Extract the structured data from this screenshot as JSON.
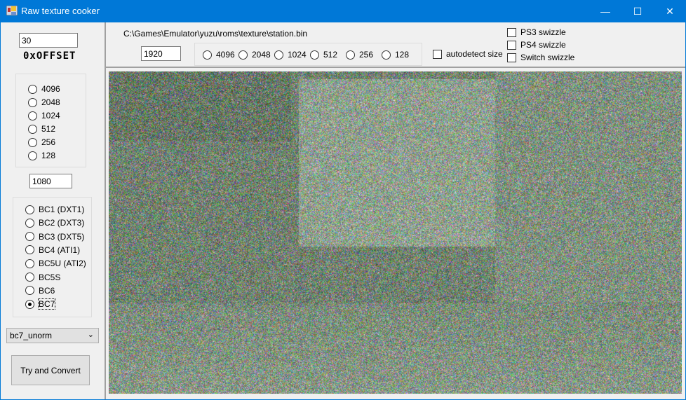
{
  "window": {
    "title": "Raw texture cooker",
    "icon": "app-icon",
    "controls": [
      "minimize-icon",
      "maximize-icon",
      "close-icon"
    ]
  },
  "left": {
    "offset_value": "30",
    "offset_label": "0xOFFSET",
    "height_sizes": [
      "4096",
      "2048",
      "1024",
      "512",
      "256",
      "128"
    ],
    "height_value": "1080",
    "formats": [
      "BC1 (DXT1)",
      "BC2 (DXT3)",
      "BC3 (DXT5)",
      "BC4 (ATI1)",
      "BC5U (ATI2)",
      "BC5S",
      "BC6",
      "BC7"
    ],
    "selected_format": "BC7",
    "format_variant": "bc7_unorm",
    "convert_label": "Try and Convert"
  },
  "top": {
    "file_path": "C:\\Games\\Emulator\\yuzu\\roms\\texture\\station.bin",
    "width_value": "1920",
    "width_sizes": [
      "4096",
      "2048",
      "1024",
      "512",
      "256",
      "128"
    ],
    "autodetect_label": "autodetect size",
    "swizzles": [
      "PS3 swizzle",
      "PS4 swizzle",
      "Switch swizzle"
    ]
  },
  "colors": {
    "titlebar": "#0078d7",
    "background": "#f0f0f0"
  }
}
